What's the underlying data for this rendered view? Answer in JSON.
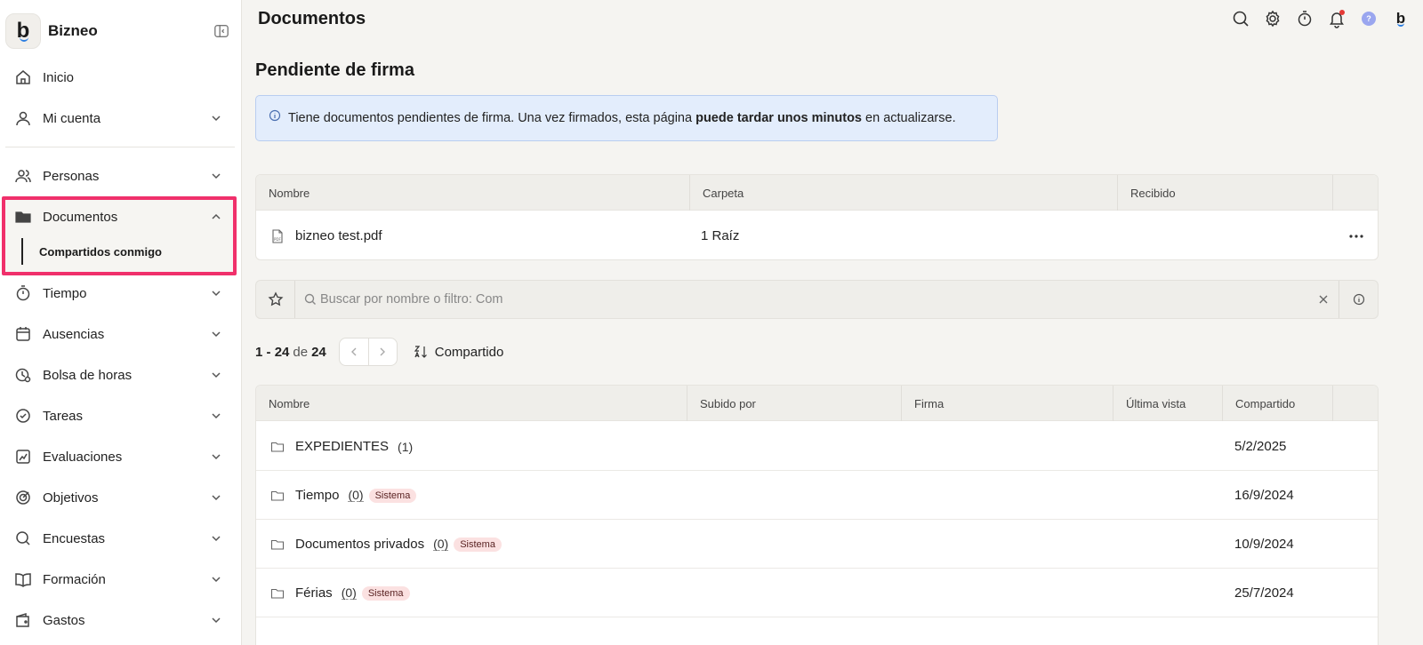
{
  "app": {
    "name": "Bizneo",
    "logo_letter": "b"
  },
  "sidebar": {
    "items": [
      {
        "label": "Inicio",
        "icon": "home-icon"
      },
      {
        "label": "Mi cuenta",
        "icon": "user-icon"
      },
      {
        "label": "Personas",
        "icon": "users-icon"
      },
      {
        "label": "Documentos",
        "icon": "folder-icon",
        "expanded": true
      },
      {
        "label": "Tiempo",
        "icon": "stopwatch-icon"
      },
      {
        "label": "Ausencias",
        "icon": "calendar-icon"
      },
      {
        "label": "Bolsa de horas",
        "icon": "clock-bank-icon"
      },
      {
        "label": "Tareas",
        "icon": "check-circle-icon"
      },
      {
        "label": "Evaluaciones",
        "icon": "chart-icon"
      },
      {
        "label": "Objetivos",
        "icon": "target-icon"
      },
      {
        "label": "Encuestas",
        "icon": "survey-icon"
      },
      {
        "label": "Formación",
        "icon": "book-icon"
      },
      {
        "label": "Gastos",
        "icon": "wallet-icon"
      }
    ],
    "sub_item": "Compartidos conmigo"
  },
  "header": {
    "title": "Documentos"
  },
  "pending": {
    "title": "Pendiente de firma",
    "banner_text_1": "Tiene documentos pendientes de firma. Una vez firmados, esta página ",
    "banner_bold": "puede tardar unos minutos",
    "banner_text_2": " en actualizarse.",
    "columns": [
      "Nombre",
      "Carpeta",
      "Recibido"
    ],
    "rows": [
      {
        "name": "bizneo test.pdf",
        "folder": "1 Raíz",
        "received": ""
      }
    ]
  },
  "search": {
    "placeholder": "Buscar por nombre o filtro: Com"
  },
  "pager": {
    "from": "1",
    "to": "24",
    "of_label": "de",
    "total": "24",
    "sort_label": "Compartido"
  },
  "files": {
    "columns": [
      "Nombre",
      "Subido por",
      "Firma",
      "Última vista",
      "Compartido"
    ],
    "rows": [
      {
        "name": "EXPEDIENTES",
        "count": "(1)",
        "badge": "",
        "shared": "5/2/2025"
      },
      {
        "name": "Tiempo",
        "count": "(0)",
        "badge": "Sistema",
        "shared": "16/9/2024"
      },
      {
        "name": "Documentos privados",
        "count": "(0)",
        "badge": "Sistema",
        "shared": "10/9/2024"
      },
      {
        "name": "Férias",
        "count": "(0)",
        "badge": "Sistema",
        "shared": "25/7/2024"
      }
    ]
  },
  "colors": {
    "accent": "#f0306b",
    "info_bg": "#e3edfc",
    "badge_bg": "#fbe1e1"
  }
}
